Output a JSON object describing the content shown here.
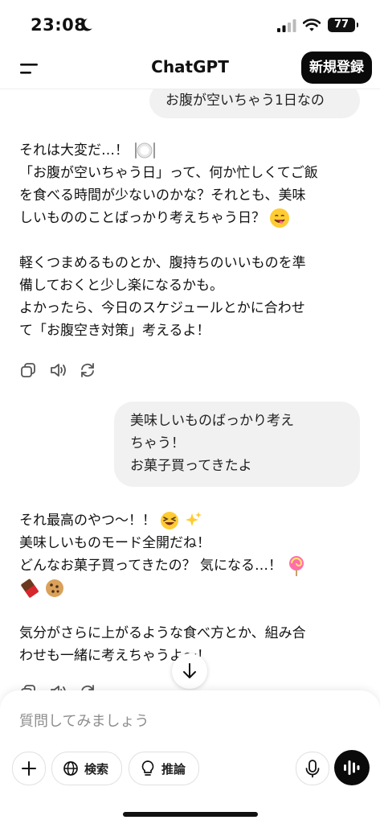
{
  "status_bar": {
    "time": "23:08",
    "battery": "77"
  },
  "header": {
    "title": "ChatGPT",
    "signup_label": "新規登録"
  },
  "messages": {
    "user1": "お腹が空いちゃう1日なの",
    "ai1": {
      "l1": "それは大変だ…！",
      "l2": "「お腹が空いちゃう日」って、何か忙しくてご飯",
      "l3": "を食べる時間が少ないのかな？それとも、美味",
      "l4": "しいもののことばっかり考えちゃう日？",
      "l5": "軽くつまめるものとか、腹持ちのいいものを準",
      "l6": "備しておくと少し楽になるかも。",
      "l7": "よかったら、今日のスケジュールとかに合わせ",
      "l8": "て「お腹空き対策」考えるよ！"
    },
    "user2": {
      "l1": "美味しいものばっかり考え",
      "l2": "ちゃう！",
      "l3": "お菓子買ってきたよ"
    },
    "ai2": {
      "l1": "それ最高のやつ〜！！",
      "l2": "美味しいものモード全開だね！",
      "l3": "どんなお菓子買ってきたの？ 気になる…！",
      "l5": "気分がさらに上がるような食べ方とか、組み合",
      "l6": "わせも一緒に考えちゃうよ〜！"
    }
  },
  "composer": {
    "placeholder": "質問してみましょう",
    "search_label": "検索",
    "reason_label": "推論"
  },
  "icons": [
    "moon-icon",
    "signal-icon",
    "wifi-icon",
    "menu-icon",
    "plate-icon",
    "smile-emoji",
    "copy-icon",
    "speaker-icon",
    "regenerate-icon",
    "laugh-emoji",
    "sparkles-emoji",
    "lollipop-emoji",
    "chocolate-emoji",
    "cookie-emoji",
    "arrow-down-icon",
    "plus-icon",
    "globe-icon",
    "bulb-icon",
    "mic-icon",
    "voice-wave-icon"
  ]
}
